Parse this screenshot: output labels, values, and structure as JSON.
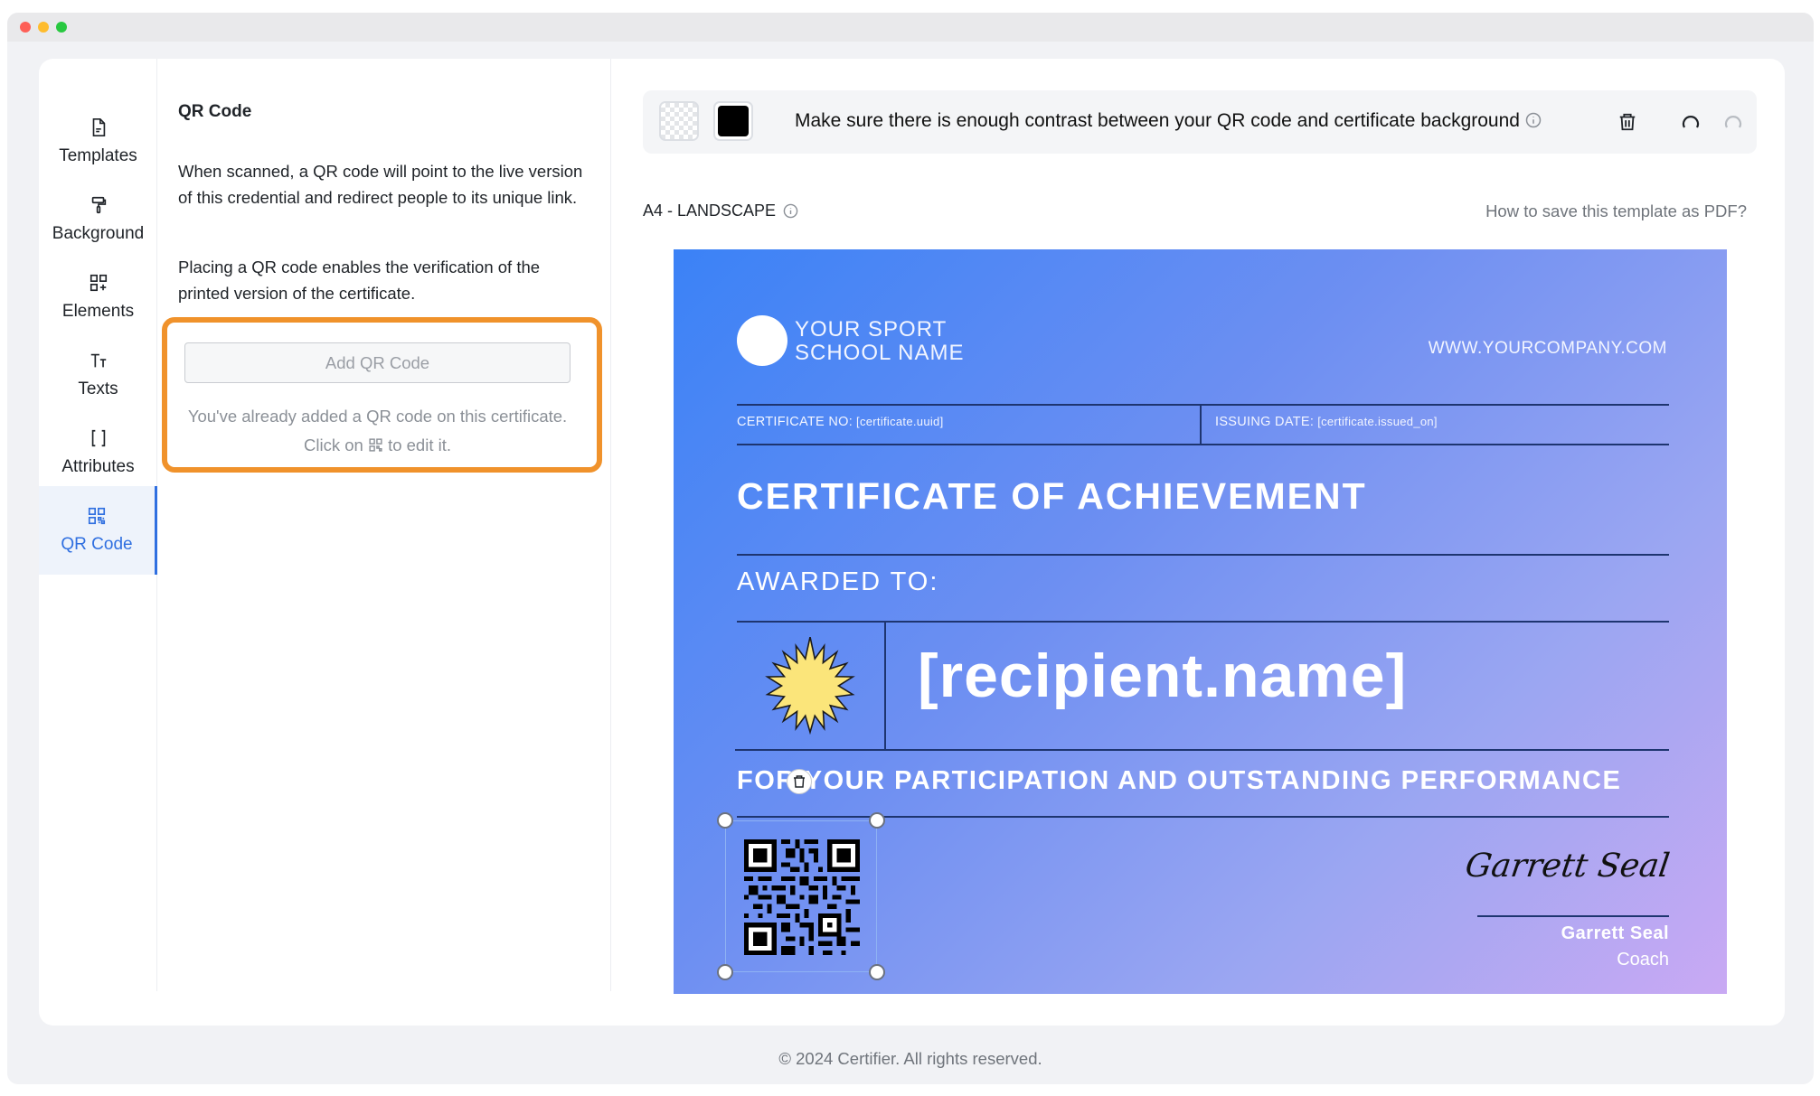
{
  "sidebar": {
    "items": [
      {
        "label": "Templates",
        "icon": "document-icon"
      },
      {
        "label": "Background",
        "icon": "paint-roller-icon"
      },
      {
        "label": "Elements",
        "icon": "elements-grid-icon"
      },
      {
        "label": "Texts",
        "icon": "text-icon"
      },
      {
        "label": "Attributes",
        "icon": "brackets-icon"
      },
      {
        "label": "QR Code",
        "icon": "qr-code-icon",
        "active": true
      }
    ],
    "active_color": "#2f6fe0"
  },
  "panel": {
    "title": "QR Code",
    "paragraph1": "When scanned, a QR code will point to the live version of this credential and redirect people to its unique link.",
    "paragraph2": "Placing a QR code enables the verification of the printed version of the certificate.",
    "add_button": "Add QR Code",
    "note_before": "You've already added a QR code on this certificate. Click on",
    "note_after": "to edit it.",
    "highlight_color": "#f0922b"
  },
  "toolbar": {
    "contrast_message": "Make sure there is enough contrast between your QR code and certificate background",
    "qr_color": "#000000"
  },
  "canvas": {
    "paper_size": "A4 - LANDSCAPE",
    "pdf_help_link": "How to save this template as PDF?"
  },
  "certificate": {
    "school_line1": "YOUR SPORT",
    "school_line2": "SCHOOL NAME",
    "website": "WWW.YOURCOMPANY.COM",
    "cert_no_label": "CERTIFICATE NO:",
    "cert_no_value": "[certificate.uuid]",
    "issue_date_label": "ISSUING DATE:",
    "issue_date_value": "[certificate.issued_on]",
    "title": "CERTIFICATE OF ACHIEVEMENT",
    "awarded_to": "AWARDED TO:",
    "recipient": "[recipient.name]",
    "participation": "FOR YOUR PARTICIPATION AND OUTSTANDING PERFORMANCE",
    "signature": "Garrett Seal",
    "signer_name": "Garrett Seal",
    "signer_role": "Coach",
    "gradient_start": "#3b82f6",
    "gradient_end": "#c9a9f3"
  },
  "footer": {
    "copyright": "© 2024 Certifier. All rights reserved."
  }
}
